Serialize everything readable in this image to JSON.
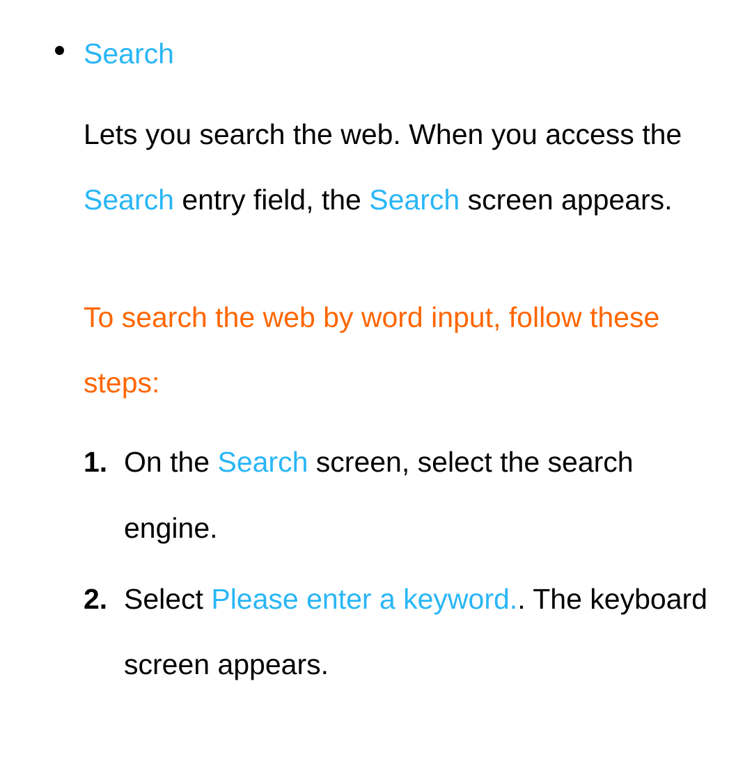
{
  "section": {
    "title": "Search",
    "description": {
      "pre": "Lets you search the web. When you access the ",
      "link1": "Search",
      "mid": " entry field, the ",
      "link2": "Search",
      "post": " screen appears."
    },
    "introHeading": "To search the web by word input, follow these steps:",
    "steps": [
      {
        "marker": "1.",
        "pre": "On the ",
        "link": "Search",
        "post": " screen, select the search engine."
      },
      {
        "marker": "2.",
        "pre": "Select ",
        "link": "Please enter a keyword.",
        "post": ". The keyboard screen appears."
      }
    ]
  }
}
